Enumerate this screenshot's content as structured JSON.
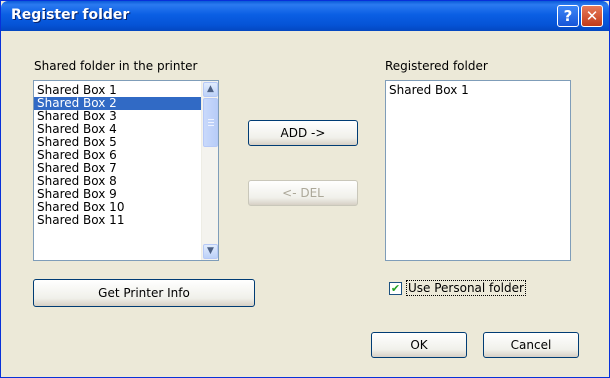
{
  "window": {
    "title": "Register folder",
    "help_icon_glyph": "?",
    "close_icon_glyph": "✕"
  },
  "shared": {
    "label": "Shared folder in the printer",
    "items": [
      {
        "label": "Shared Box 1",
        "selected": false
      },
      {
        "label": "Shared Box 2",
        "selected": true
      },
      {
        "label": "Shared Box 3",
        "selected": false
      },
      {
        "label": "Shared Box 4",
        "selected": false
      },
      {
        "label": "Shared Box 5",
        "selected": false
      },
      {
        "label": "Shared Box 6",
        "selected": false
      },
      {
        "label": "Shared Box 7",
        "selected": false
      },
      {
        "label": "Shared Box 8",
        "selected": false
      },
      {
        "label": "Shared Box 9",
        "selected": false
      },
      {
        "label": "Shared Box 10",
        "selected": false
      },
      {
        "label": "Shared Box 11",
        "selected": false
      }
    ]
  },
  "registered": {
    "label": "Registered folder",
    "items": [
      "Shared Box 1"
    ]
  },
  "buttons": {
    "add": "ADD ->",
    "del": "<- DEL",
    "get_info": "Get Printer Info",
    "ok": "OK",
    "cancel": "Cancel"
  },
  "personal": {
    "label": "Use Personal folder",
    "checked": true,
    "check_glyph": "✔"
  },
  "colors": {
    "titlebar": "#0553d6",
    "selection": "#316ac5",
    "dialog_bg": "#ece9d8"
  }
}
